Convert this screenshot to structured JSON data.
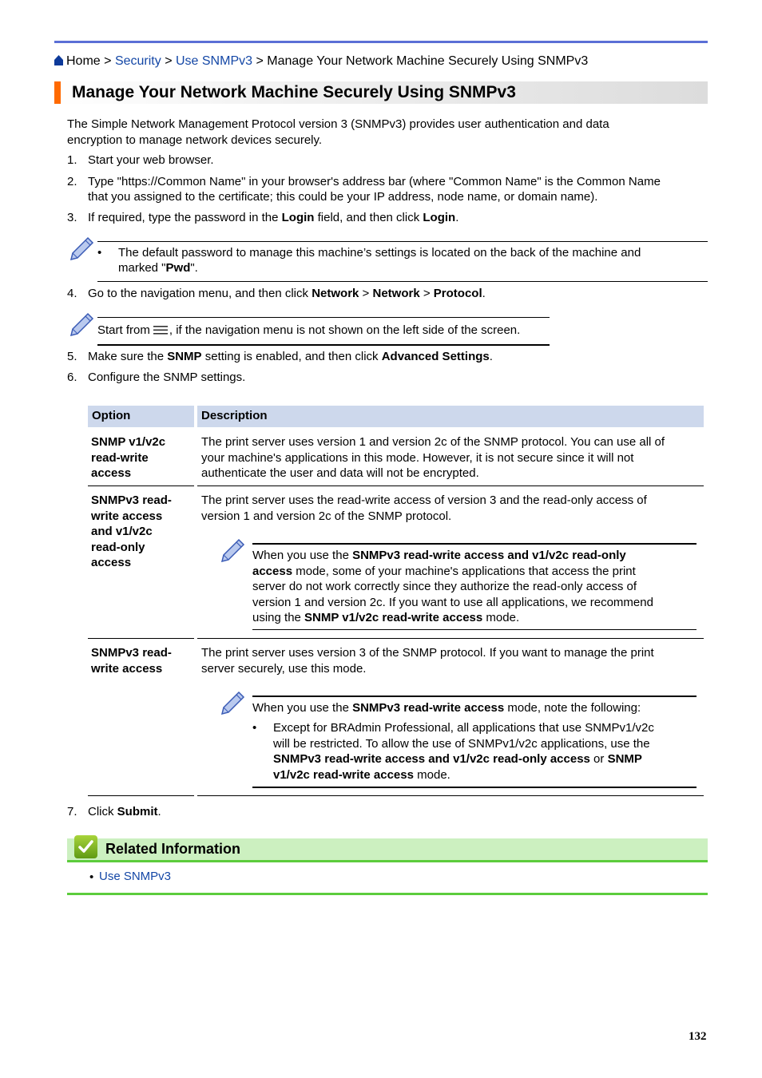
{
  "breadcrumb": {
    "home_icon": "home-icon",
    "home": "Home",
    "sep": ">",
    "items": [
      "Security",
      "Use SNMPv3"
    ],
    "current": "Manage Your Network Machine Securely Using SNMPv3"
  },
  "page_title": "Manage Your Network Machine Securely Using SNMPv3",
  "intro": [
    "The Simple Network Management Protocol version 3 (SNMPv3) provides user authentication and data",
    "encryption to manage network devices securely."
  ],
  "steps": [
    {
      "num": "1.",
      "text": "Start your web browser."
    },
    {
      "num": "2.",
      "lines": [
        "Type \"https://Common Name\" in your browser's address bar (where \"Common Name\" is the Common Name",
        "that you assigned to the certificate; this could be your IP address, node name, or domain name)."
      ]
    },
    {
      "num": "3.",
      "pre": "If required, type the password in the ",
      "b1": "Login",
      "mid": " field, and then click ",
      "b2": "Login",
      "post": "."
    },
    {
      "num": "4.",
      "pre": "Go to the navigation menu, and then click ",
      "b1": "Network",
      "sep1": " > ",
      "b2": "Network",
      "sep2": " > ",
      "b3": "Protocol",
      "post": "."
    },
    {
      "num": "5.",
      "pre": "Make sure the ",
      "b1": "SNMP",
      "mid": " setting is enabled, and then click ",
      "b2": "Advanced Settings",
      "post": "."
    },
    {
      "num": "6.",
      "text": "Configure the SNMP settings."
    },
    {
      "num": "7.",
      "pre": "Click ",
      "b1": "Submit",
      "post": "."
    }
  ],
  "note1": {
    "icon": "pencil-note-icon",
    "bullet": "•",
    "line1": "The default password to manage this machine’s settings is located on the back of the machine and",
    "line2_pre": "marked \"",
    "line2_b": "Pwd",
    "line2_post": "\"."
  },
  "note2": {
    "icon": "pencil-note-icon",
    "pre": "Start from",
    "menu_icon": "menu-icon",
    "post": ", if the navigation menu is not shown on the left side of the screen."
  },
  "table": {
    "headers": [
      "Option",
      "Description"
    ],
    "rows": [
      {
        "option": [
          "SNMP v1/v2c",
          "read-write",
          "access"
        ],
        "description": [
          "The print server uses version 1 and version 2c of the SNMP protocol. You can use all of",
          "your machine's applications in this mode. However, it is not secure since it will not",
          "authenticate the user and data will not be encrypted."
        ]
      },
      {
        "option": [
          "SNMPv3 read-",
          "write access",
          "and v1/v2c",
          "read-only",
          "access"
        ],
        "description": [
          "The print server uses the read-write access of version 3 and the read-only access of",
          "version 1 and version 2c of the SNMP protocol."
        ],
        "note": {
          "l1_pre": "When you use the ",
          "l1_b": "SNMPv3 read-write access and v1/v2c read-only",
          "l2_b": "access",
          "l2_post": " mode, some of your machine's applications that access the print",
          "l3": "server do not work correctly since they authorize the read-only access of",
          "l4": "version 1 and version 2c. If you want to use all applications, we recommend",
          "l5_pre": "using the ",
          "l5_b": "SNMP v1/v2c read-write access",
          "l5_post": " mode."
        }
      },
      {
        "option": [
          "SNMPv3 read-",
          "write access"
        ],
        "description": [
          "The print server uses version 3 of the SNMP protocol. If you want to manage the print",
          "server securely, use this mode."
        ],
        "note": {
          "l1_pre": "When you use the ",
          "l1_b": "SNMPv3 read-write access",
          "l1_post": " mode, note the following:",
          "bullet": "•",
          "b_l1": "Except for BRAdmin Professional, all applications that use SNMPv1/v2c",
          "b_l2": "will be restricted. To allow the use of SNMPv1/v2c applications, use the",
          "b_l3_b1": "SNMPv3 read-write access and v1/v2c read-only access",
          "b_l3_mid": " or ",
          "b_l3_b2": "SNMP",
          "b_l4_b": "v1/v2c read-write access",
          "b_l4_post": " mode."
        }
      }
    ]
  },
  "related": {
    "icon": "checkmark-icon",
    "title": "Related Information",
    "bullet": "•",
    "links": [
      "Use SNMPv3"
    ]
  },
  "page_number": "132",
  "colors": {
    "accent_orange": "#ff6a00",
    "top_rule_blue": "#5b6fd6",
    "link_blue": "#1447a6",
    "table_header_bg": "#cdd8ec",
    "related_bg": "#ccf0c0",
    "related_rule": "#5ccc3c"
  }
}
